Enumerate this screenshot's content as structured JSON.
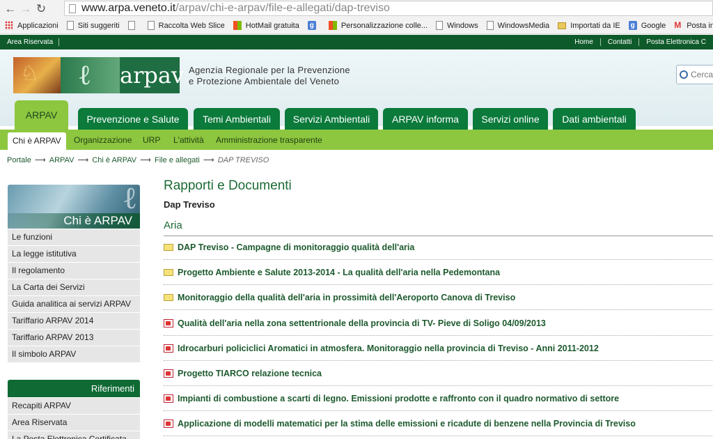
{
  "browser": {
    "url_domain": "www.arpa.veneto.it",
    "url_path": "/arpav/chi-e-arpav/file-e-allegati/dap-treviso",
    "bookmarks": [
      "Applicazioni",
      "Siti suggeriti",
      "Raccolta Web Slice",
      "HotMail gratuita",
      "Personalizzazione colle...",
      "Windows",
      "WindowsMedia",
      "Importati da IE",
      "Google",
      "Posta in arrivo"
    ]
  },
  "topstrip": {
    "left": "Area Riservata",
    "right": [
      "Home",
      "Contatti",
      "Posta Elettronica C"
    ]
  },
  "header": {
    "logo_text": "arpav",
    "agency_line1": "Agenzia Regionale per la Prevenzione",
    "agency_line2": "e Protezione Ambientale del Veneto",
    "search_placeholder": "Cerca"
  },
  "tabs": [
    "ARPAV",
    "Prevenzione e Salute",
    "Temi Ambientali",
    "Servizi Ambientali",
    "ARPAV informa",
    "Servizi online",
    "Dati ambientali"
  ],
  "subnav": [
    "Chi è ARPAV",
    "Organizzazione",
    "URP",
    "L'attività",
    "Amministrazione trasparente"
  ],
  "breadcrumb": [
    "Portale",
    "ARPAV",
    "Chi è ARPAV",
    "File e allegati",
    "DAP TREVISO"
  ],
  "sidebar": {
    "banner_title": "Chi è ARPAV",
    "items": [
      "Le funzioni",
      "La legge istitutiva",
      "Il regolamento",
      "La Carta dei Servizi",
      "Guida analitica ai servizi ARPAV",
      "Tariffario ARPAV 2014",
      "Tariffario ARPAV 2013",
      "Il simbolo ARPAV"
    ],
    "ref_title": "Riferimenti",
    "ref_items": [
      "Recapiti ARPAV",
      "Area Riservata",
      "La Posta Elettronica Certificata"
    ]
  },
  "main": {
    "title": "Rapporti e Documenti",
    "subtitle": "Dap Treviso",
    "section": "Aria",
    "docs": [
      {
        "label": "DAP Treviso - Campagne di monitoraggio qualità dell'aria",
        "icon": "folder-icon"
      },
      {
        "label": "Progetto Ambiente e Salute 2013-2014 - La qualità dell'aria nella Pedemontana",
        "icon": "folder-icon"
      },
      {
        "label": "Monitoraggio della qualità dell'aria in prossimità dell'Aeroporto Canova di Treviso",
        "icon": "folder-icon"
      },
      {
        "label": "Qualità dell'aria nella zona settentrionale della provincia di TV- Pieve di Soligo 04/09/2013",
        "icon": "pdf-icon"
      },
      {
        "label": "Idrocarburi policiclici Aromatici in atmosfera. Monitoraggio nella provincia di Treviso - Anni 2011-2012",
        "icon": "pdf-icon"
      },
      {
        "label": "Progetto TIARCO relazione tecnica",
        "icon": "pdf-icon"
      },
      {
        "label": "Impianti di combustione a scarti di legno. Emissioni prodotte e raffronto con il quadro normativo di settore",
        "icon": "pdf-icon"
      },
      {
        "label": "Applicazione di modelli matematici per la stima delle emissioni e ricadute di benzene nella Provincia di Treviso",
        "icon": "pdf-icon"
      }
    ]
  }
}
